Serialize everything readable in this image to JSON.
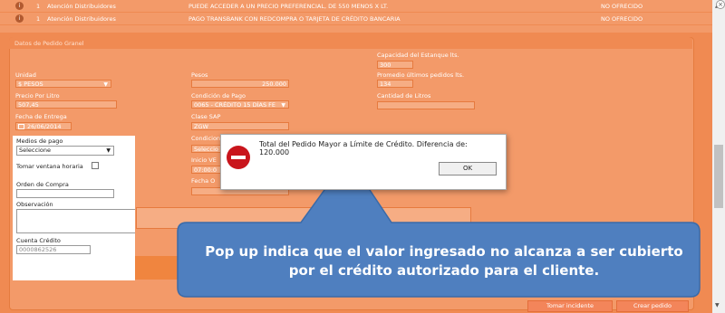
{
  "top_rows": [
    {
      "num": "1",
      "category": "Atención Distribuidores",
      "message": "PUEDE ACCEDER A UN PRECIO PREFERENCIAL, DE 550 MENOS X LT.",
      "status": "NO OFRECIDO"
    },
    {
      "num": "1",
      "category": "Atención Distribuidores",
      "message": "PAGO TRANSBANK CON REDCOMPRA O TARJETA DE CRÉDITO BANCARIA",
      "status": "NO OFRECIDO"
    }
  ],
  "panel": {
    "title": "Datos de Pedido Granel",
    "capacidad_label": "Capacidad del Estanque lts.",
    "capacidad_value": "300",
    "unidad_label": "Unidad",
    "unidad_value": "$ PESOS",
    "pesos_label": "Pesos",
    "pesos_value": "250.000",
    "promedio_label": "Promedio últimos pedidos lts.",
    "promedio_value": "134",
    "precio_label": "Precio Por Litro",
    "precio_value": "507,45",
    "condicion_label": "Condición de Pago",
    "condicion_value": "0065 - CRÉDITO 15 DÍAS FE",
    "cantidad_label": "Cantidad de Litros",
    "fecha_label": "Fecha de Entrega",
    "fecha_value": "26/06/2014",
    "clase_label": "Clase SAP",
    "clase_value": "ZGW",
    "condicion2_label": "Condicion",
    "condicion2_value": "Seleccio",
    "inicio_label": "Inicio VE",
    "inicio_value": "07:00:0",
    "fecha2_label": "Fecha O"
  },
  "whitebox": {
    "medios_label": "Medios de pago",
    "medios_value": "Seleccione",
    "ventana_label": "Tomar ventana horaria",
    "orden_label": "Orden de Compra",
    "observacion_label": "Observación",
    "cuenta_label": "Cuenta Crédito",
    "cuenta_value": "0000862526"
  },
  "dialog": {
    "message": "Total del Pedido Mayor a Límite de Crédito. Diferencia de: 120.000",
    "ok_label": "OK"
  },
  "callout": {
    "text": "Pop up indica que el valor ingresado no alcanza a ser cubierto por el crédito autorizado para el cliente."
  },
  "buttons": {
    "tomar_incidente": "Tomar incidente",
    "crear_pedido": "Crear pedido"
  },
  "colors": {
    "orange": "#f08a52",
    "callout_blue": "#4f7fbf",
    "error_red": "#c9151c"
  }
}
